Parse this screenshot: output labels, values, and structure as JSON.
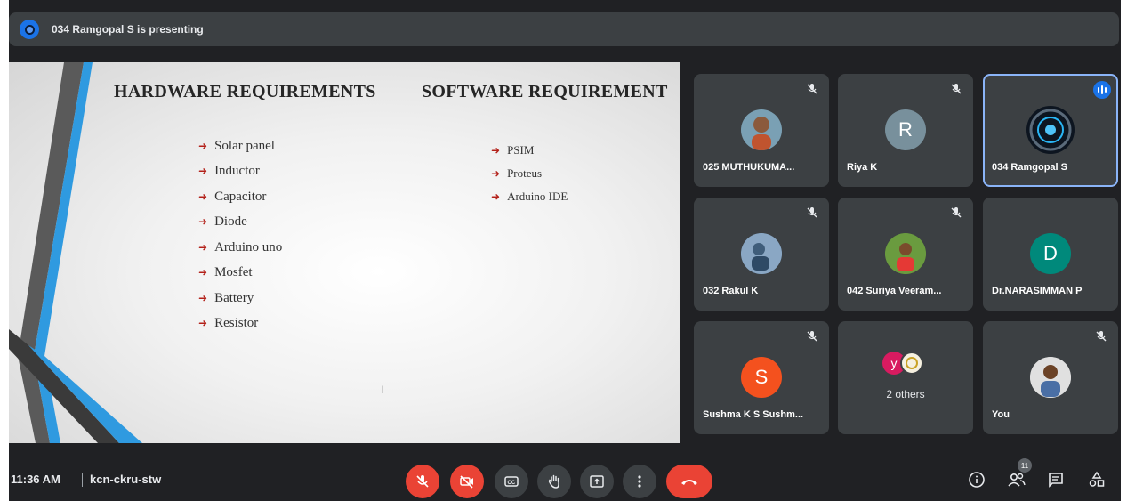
{
  "presenting_bar": {
    "text": "034 Ramgopal S is presenting"
  },
  "slide": {
    "hardware_title": "HARDWARE REQUIREMENTS",
    "software_title": "SOFTWARE REQUIREMENT",
    "hardware_items": [
      "Solar panel",
      "Inductor",
      "Capacitor",
      "Diode",
      "Arduino uno",
      "Mosfet",
      "Battery",
      "Resistor"
    ],
    "software_items": [
      "PSIM",
      "Proteus",
      "Arduino IDE"
    ],
    "bullet_icon": "arrow-bullet",
    "bullet_color": "#b32019"
  },
  "participants": [
    {
      "name": "025 MUTHUKUMA...",
      "avatar_type": "photo",
      "muted": true
    },
    {
      "name": "Riya K",
      "avatar_type": "letter",
      "letter": "R",
      "color": "#78909c",
      "muted": true
    },
    {
      "name": "034 Ramgopal S",
      "avatar_type": "logo",
      "muted": false,
      "speaking": true,
      "active": true
    },
    {
      "name": "032 Rakul K",
      "avatar_type": "photo",
      "muted": true
    },
    {
      "name": "042 Suriya Veeram...",
      "avatar_type": "photo",
      "muted": true
    },
    {
      "name": "Dr.NARASIMMAN P",
      "avatar_type": "letter",
      "letter": "D",
      "color": "#00897b",
      "muted": false
    },
    {
      "name": "Sushma K S Sushm...",
      "avatar_type": "letter",
      "letter": "S",
      "color": "#f4511e",
      "muted": true
    },
    {
      "name": "",
      "others_label": "2 others",
      "avatar_type": "group",
      "letter": "y",
      "color": "#d81b60"
    },
    {
      "name": "You",
      "avatar_type": "photo",
      "muted": true
    }
  ],
  "bottom_bar": {
    "time": "11:36 AM",
    "separator": "|",
    "meeting_code": "kcn-ckru-stw",
    "participant_count": "11",
    "controls": [
      "mic-off-icon",
      "camera-off-icon",
      "captions-icon",
      "raise-hand-icon",
      "present-icon",
      "more-options-icon",
      "end-call-icon"
    ],
    "right_icons": [
      "info-icon",
      "people-icon",
      "chat-icon",
      "activities-icon"
    ]
  },
  "colors": {
    "background": "#202124",
    "tile": "#3c4043",
    "danger": "#ea4335",
    "accent": "#1a73e8",
    "active_border": "#8ab4f8"
  }
}
